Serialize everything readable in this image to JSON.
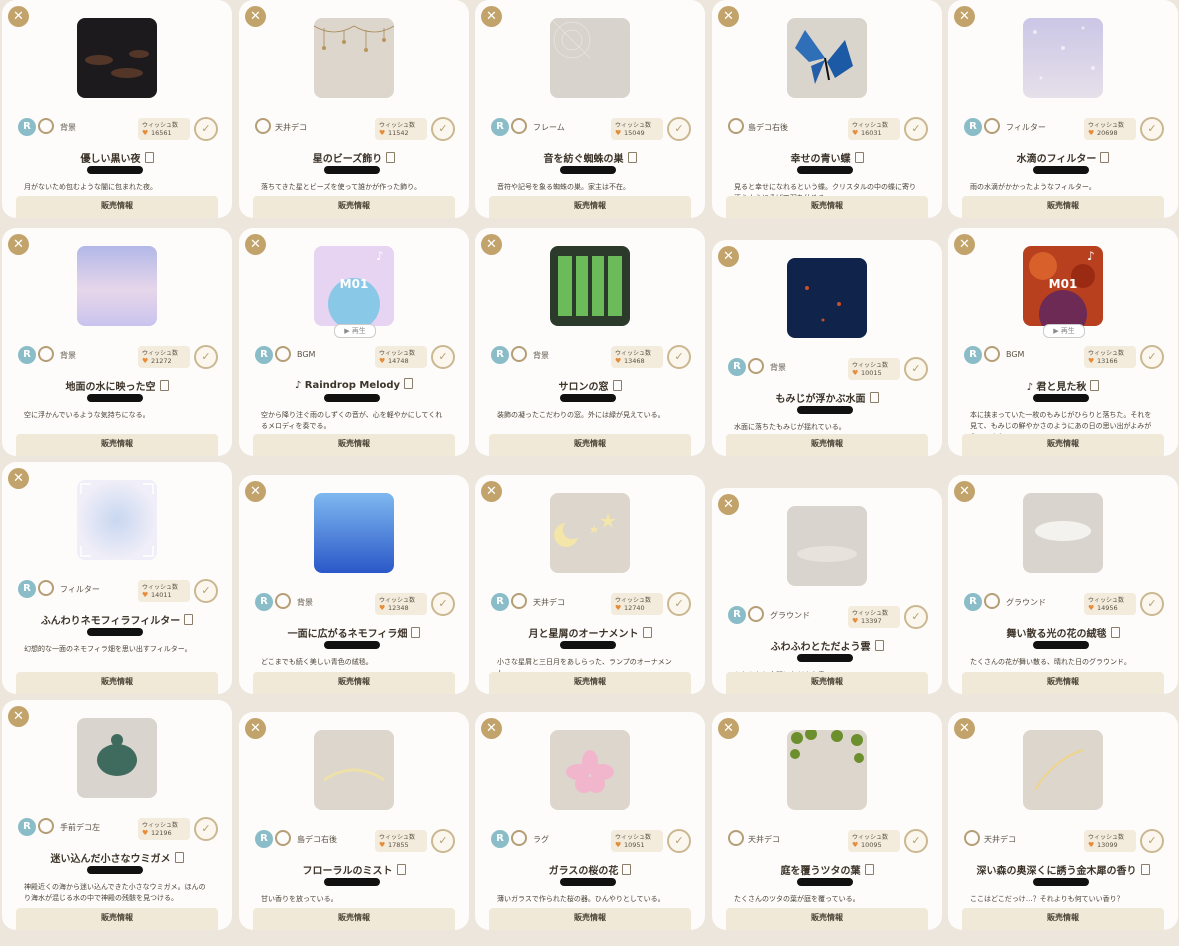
{
  "sale_label": "販売情報",
  "wish_label": "ウィッシュ数",
  "play_label": "▶ 再生",
  "rank_label": "R",
  "cards": [
    {
      "title": "優しい黒い夜",
      "category": "背景",
      "wish": "16561",
      "rank": true,
      "desc": "月がないため包むような闇に包まれた夜。",
      "thumb": "night"
    },
    {
      "title": "星のビーズ飾り",
      "category": "天井デコ",
      "wish": "11542",
      "rank": false,
      "desc": "落ちてきた星とビーズを使って誰かが作った飾り。",
      "thumb": "beads"
    },
    {
      "title": "音を紡ぐ蜘蛛の巣",
      "category": "フレーム",
      "wish": "15049",
      "rank": true,
      "desc": "音符や記号を象る蜘蛛の巣。家主は不在。",
      "thumb": "web"
    },
    {
      "title": "幸せの青い蝶",
      "category": "島デコ右後",
      "wish": "16031",
      "rank": false,
      "desc": "見ると幸せになれるという蝶。クリスタルの中の蝶に寄り添うようにそばで羽を休める。",
      "thumb": "butterfly"
    },
    {
      "title": "水滴のフィルター",
      "category": "フィルター",
      "wish": "20698",
      "rank": true,
      "desc": "雨の水滴がかかったようなフィルター。",
      "thumb": "drops"
    },
    {
      "title": "地面の水に映った空",
      "category": "背景",
      "wish": "21272",
      "rank": true,
      "desc": "空に浮かんでいるような気持ちになる。",
      "thumb": "sky"
    },
    {
      "title": "♪ Raindrop Melody",
      "category": "BGM",
      "wish": "14748",
      "rank": true,
      "desc": "空から降り注ぐ雨のしずくの音が、心を軽やかにしてくれるメロディを奏でる。",
      "thumb": "bgm_blue",
      "m01": "M01"
    },
    {
      "title": "サロンの窓",
      "category": "背景",
      "wish": "13468",
      "rank": true,
      "desc": "装飾の凝ったこだわりの窓。外には緑が見えている。",
      "thumb": "window"
    },
    {
      "title": "もみじが浮かぶ水面",
      "category": "背景",
      "wish": "10015",
      "rank": true,
      "desc": "水面に落ちたもみじが揺れている。",
      "thumb": "pond"
    },
    {
      "title": "♪ 君と見た秋",
      "category": "BGM",
      "wish": "13166",
      "rank": true,
      "desc": "本に挟まっていた一枚のもみじがひらりと落ちた。それを見て、もみじの鮮やかさのようにあの日の思い出がよみがえってきた。",
      "thumb": "bgm_red",
      "m01": "M01"
    },
    {
      "title": "ふんわりネモフィラフィルター",
      "category": "フィルター",
      "wish": "14011",
      "rank": true,
      "desc": "幻想的な一面のネモフィラ畑を思い出すフィルター。",
      "thumb": "nemofilter"
    },
    {
      "title": "一面に広がるネモフィラ畑",
      "category": "背景",
      "wish": "12348",
      "rank": true,
      "desc": "どこまでも続く美しい青色の絨毯。",
      "thumb": "nemofield"
    },
    {
      "title": "月と星屑のオーナメント",
      "category": "天井デコ",
      "wish": "12740",
      "rank": true,
      "desc": "小さな星屑と三日月をあしらった、ランプのオーナメント。",
      "thumb": "moon"
    },
    {
      "title": "ふわふわとただよう雲",
      "category": "グラウンド",
      "wish": "13397",
      "rank": true,
      "desc": "ふわふわと空間にただよう雲。",
      "thumb": "cloud"
    },
    {
      "title": "舞い散る光の花の絨毯",
      "category": "グラウンド",
      "wish": "14956",
      "rank": true,
      "desc": "たくさんの花が舞い散る、晴れた日のグラウンド。",
      "thumb": "flowers"
    },
    {
      "title": "迷い込んだ小さなウミガメ",
      "category": "手前デコ左",
      "wish": "12196",
      "rank": true,
      "desc": "神殿近くの海から迷い込んできた小さなウミガメ。ほんのり海水が混じる水の中で神殿の残骸を見つける。",
      "thumb": "turtle"
    },
    {
      "title": "フローラルのミスト",
      "category": "島デコ右後",
      "wish": "17855",
      "rank": true,
      "desc": "甘い香りを放っている。",
      "thumb": "mist"
    },
    {
      "title": "ガラスの桜の花",
      "category": "ラグ",
      "wish": "10951",
      "rank": true,
      "desc": "薄いガラスで作られた桜の器。ひんやりとしている。",
      "thumb": "sakura"
    },
    {
      "title": "庭を覆うツタの葉",
      "category": "天井デコ",
      "wish": "10095",
      "rank": false,
      "desc": "たくさんのツタの葉が庭を覆っている。",
      "thumb": "ivy"
    },
    {
      "title": "深い森の奥深くに誘う金木犀の香り",
      "category": "天井デコ",
      "wish": "13099",
      "rank": false,
      "desc": "ここはどこだっけ…？それよりも何ていい香り？",
      "thumb": "osmanthus"
    }
  ]
}
